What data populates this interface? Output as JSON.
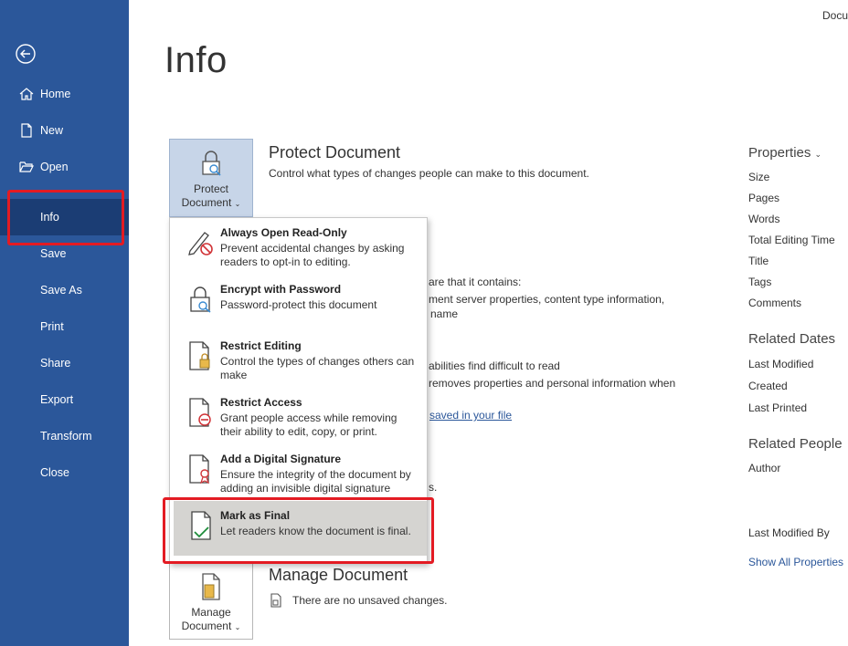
{
  "window": {
    "doc_name": "Docu"
  },
  "sidebar": {
    "items": [
      {
        "label": "Home",
        "icon": "home-icon"
      },
      {
        "label": "New",
        "icon": "new-document-icon"
      },
      {
        "label": "Open",
        "icon": "folder-open-icon"
      },
      {
        "label": "Info",
        "active": true
      },
      {
        "label": "Save"
      },
      {
        "label": "Save As"
      },
      {
        "label": "Print"
      },
      {
        "label": "Share"
      },
      {
        "label": "Export"
      },
      {
        "label": "Transform"
      },
      {
        "label": "Close"
      }
    ]
  },
  "main": {
    "title": "Info",
    "protect": {
      "tile_label_1": "Protect",
      "tile_label_2": "Document",
      "title": "Protect Document",
      "description": "Control what types of changes people can make to this document."
    },
    "inspect_fragments": {
      "line1": "are that it contains:",
      "line2": "ment server properties, content type information,",
      "line3": "name",
      "line4": "abilities find difficult to read",
      "line5": "removes properties and personal information when",
      "link": "saved in your file",
      "line6": "s."
    },
    "manage": {
      "tile_label_1": "Manage",
      "tile_label_2": "Document",
      "title": "Manage Document",
      "description": "There are no unsaved changes."
    }
  },
  "properties": {
    "header": "Properties",
    "items": [
      "Size",
      "Pages",
      "Words",
      "Total Editing Time",
      "Title",
      "Tags",
      "Comments"
    ],
    "related_dates_header": "Related Dates",
    "related_dates": [
      "Last Modified",
      "Created",
      "Last Printed"
    ],
    "related_people_header": "Related People",
    "related_people": [
      "Author"
    ],
    "last_modified_by": "Last Modified By",
    "show_all": "Show All Properties"
  },
  "protect_menu": {
    "items": [
      {
        "title": "Always Open Read-Only",
        "description": "Prevent accidental changes by asking readers to opt-in to editing.",
        "icon": "pencil-no-icon"
      },
      {
        "title": "Encrypt with Password",
        "description": "Password-protect this document",
        "icon": "lock-key-icon"
      },
      {
        "title": "Restrict Editing",
        "description": "Control the types of changes others can make",
        "icon": "document-lock-icon"
      },
      {
        "title": "Restrict Access",
        "description": "Grant people access while removing their ability to edit, copy, or print.",
        "icon": "document-restrict-icon"
      },
      {
        "title": "Add a Digital Signature",
        "description": "Ensure the integrity of the document by adding an invisible digital signature",
        "icon": "document-ribbon-icon"
      },
      {
        "title": "Mark as Final",
        "description": "Let readers know the document is final.",
        "icon": "document-check-icon",
        "selected": true
      }
    ]
  },
  "colors": {
    "sidebar": "#2b579a",
    "sidebar_active": "#1b3d74",
    "highlight": "#e31b23",
    "link": "#2b579a"
  }
}
